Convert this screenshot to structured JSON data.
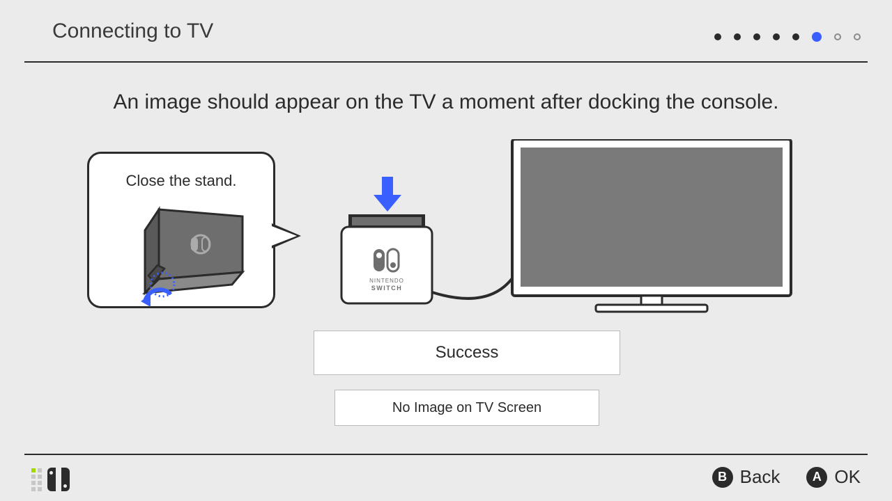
{
  "header": {
    "title": "Connecting to TV",
    "progress": {
      "total": 8,
      "current": 6
    }
  },
  "instruction": "An image should appear on the TV a moment after docking the console.",
  "tip": {
    "text": "Close the stand."
  },
  "dock": {
    "brand_top": "NINTENDO",
    "brand_bottom": "SWITCH"
  },
  "buttons": {
    "success": "Success",
    "no_image": "No Image on TV Screen"
  },
  "footer": {
    "back_glyph": "B",
    "back_label": "Back",
    "ok_glyph": "A",
    "ok_label": "OK"
  }
}
